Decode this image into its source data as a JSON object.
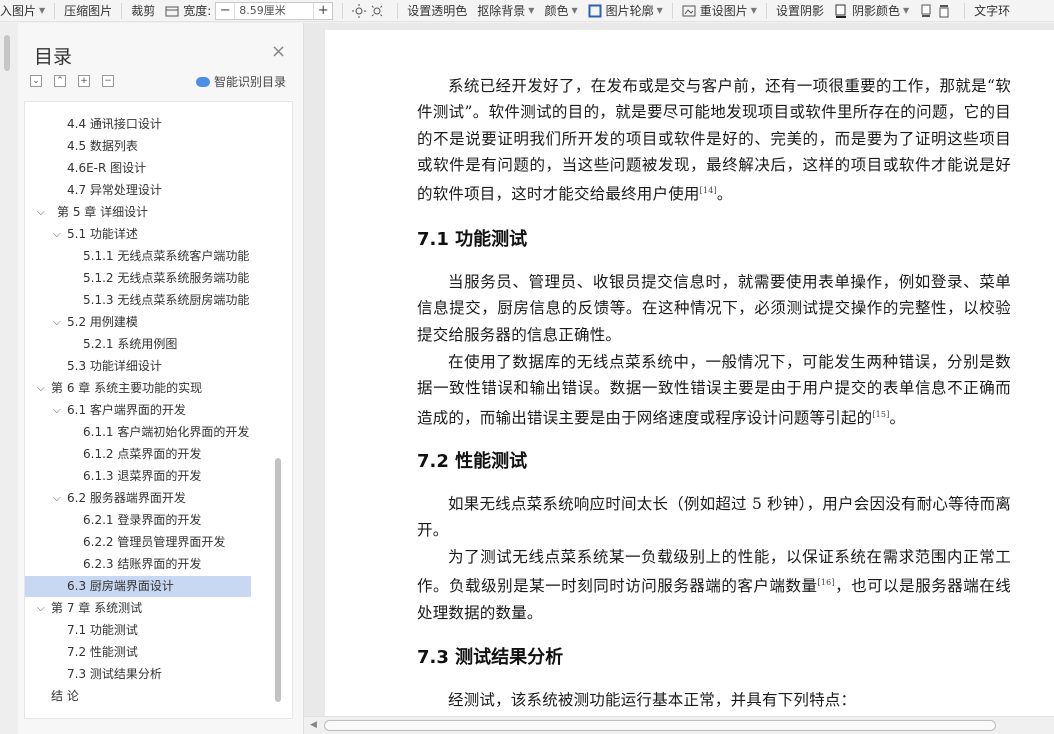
{
  "toolbar": {
    "items": [
      "入图片",
      "压缩图片",
      "裁剪",
      "宽度:",
      "设置透明色",
      "抠除背景",
      "颜色",
      "图片轮廓",
      "重设图片",
      "设置阴影",
      "阴影颜色",
      "文字环"
    ],
    "width_value": "8.59厘米",
    "minus": "−",
    "plus": "+"
  },
  "toc": {
    "title": "目录",
    "close": "×",
    "smart_label": "智能识别目录",
    "ctrl_collapse": "⌄",
    "ctrl_expand": "⌃",
    "ctrl_add": "+",
    "ctrl_remove": "−",
    "items": [
      {
        "label": "4.4 通讯接口设计"
      },
      {
        "label": "4.5 数据列表"
      },
      {
        "label": "4.6E-R 图设计"
      },
      {
        "label": "4.7 异常处理设计"
      },
      {
        "label": "第 5 章  详细设计"
      },
      {
        "label": "5.1 功能详述"
      },
      {
        "label": "5.1.1 无线点菜系统客户端功能"
      },
      {
        "label": "5.1.2 无线点菜系统服务端功能"
      },
      {
        "label": "5.1.3 无线点菜系统厨房端功能"
      },
      {
        "label": "5.2 用例建模"
      },
      {
        "label": "5.2.1 系统用例图"
      },
      {
        "label": "5.3 功能详细设计"
      },
      {
        "label": "第 6 章  系统主要功能的实现"
      },
      {
        "label": "6.1 客户端界面的开发"
      },
      {
        "label": "6.1.1 客户端初始化界面的开发"
      },
      {
        "label": "6.1.2 点菜界面的开发"
      },
      {
        "label": "6.1.3 退菜界面的开发"
      },
      {
        "label": "6.2  服务器端界面开发"
      },
      {
        "label": "6.2.1  登录界面的开发"
      },
      {
        "label": "6.2.2 管理员管理界面开发"
      },
      {
        "label": "6.2.3 结账界面的开发"
      },
      {
        "label": "6.3 厨房端界面设计"
      },
      {
        "label": "第 7 章  系统测试"
      },
      {
        "label": "7.1 功能测试"
      },
      {
        "label": "7.2 性能测试"
      },
      {
        "label": "7.3 测试结果分析"
      },
      {
        "label": "结  论"
      }
    ]
  },
  "document": {
    "p1": "系统已经开发好了，在发布或是交与客户前，还有一项很重要的工作，那就是“软件测试”。软件测试的目的，就是要尽可能地发现项目或软件里所存在的问题，它的目的不是说要证明我们所开发的项目或软件是好的、完美的，而是要为了证明这些项目或软件是有问题的，当这些问题被发现，最终解决后，这样的项目或软件才能说是好的软件项目，这时才能交给最终用户使用",
    "p1_ref": "[14]",
    "p1_end": "。",
    "h1": "7.1 功能测试",
    "p2": "当服务员、管理员、收银员提交信息时，就需要使用表单操作，例如登录、菜单信息提交，厨房信息的反馈等。在这种情况下，必须测试提交操作的完整性，以校验提交给服务器的信息正确性。",
    "p3": "在使用了数据库的无线点菜系统中，一般情况下，可能发生两种错误，分别是数据一致性错误和输出错误。数据一致性错误主要是由于用户提交的表单信息不正确而造成的，而输出错误主要是由于网络速度或程序设计问题等引起的",
    "p3_ref": "[15]",
    "p3_end": "。",
    "h2": "7.2 性能测试",
    "p4": "如果无线点菜系统响应时间太长（例如超过 5 秒钟），用户会因没有耐心等待而离开。",
    "p5": "为了测试无线点菜系统某一负载级别上的性能，以保证系统在需求范围内正常工作。负载级别是某一时刻同时访问服务器端的客户端数量",
    "p5_ref": "[16]",
    "p5_end": "，也可以是服务器端在线处理数据的数量。",
    "h3": "7.3 测试结果分析",
    "p6": "经测试，该系统被测功能运行基本正常，并具有下列特点："
  }
}
